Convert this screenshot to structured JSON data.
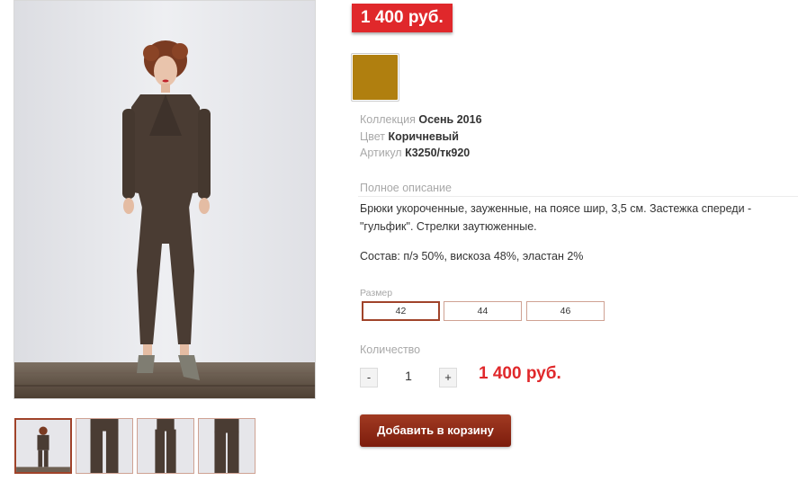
{
  "product": {
    "price_badge": "1 400 руб.",
    "color_swatch": "#b07f0f",
    "collection_key": "Коллекция",
    "collection_value": "Осень 2016",
    "color_key": "Цвет",
    "color_value": "Коричневый",
    "article_key": "Артикул",
    "article_value": "К3250/тк920",
    "description_title": "Полное описание",
    "description": "Брюки укороченные, зауженные, на поясе шир, 3,5 см.  Застежка спереди - \"гульфик\". Стрелки заутюженные.",
    "composition": "Состав: п/э 50%, вискоза 48%, эластан 2%",
    "size_label": "Размер",
    "sizes": [
      "42",
      "44",
      "46"
    ],
    "selected_size": "42",
    "quantity_label": "Количество",
    "qty_minus": "-",
    "qty_plus": "+",
    "quantity": "1",
    "total_price": "1 400 руб.",
    "add_to_cart": "Добавить в корзину"
  },
  "gallery": {
    "thumbnail_count": 4,
    "active_thumbnail": 0
  }
}
